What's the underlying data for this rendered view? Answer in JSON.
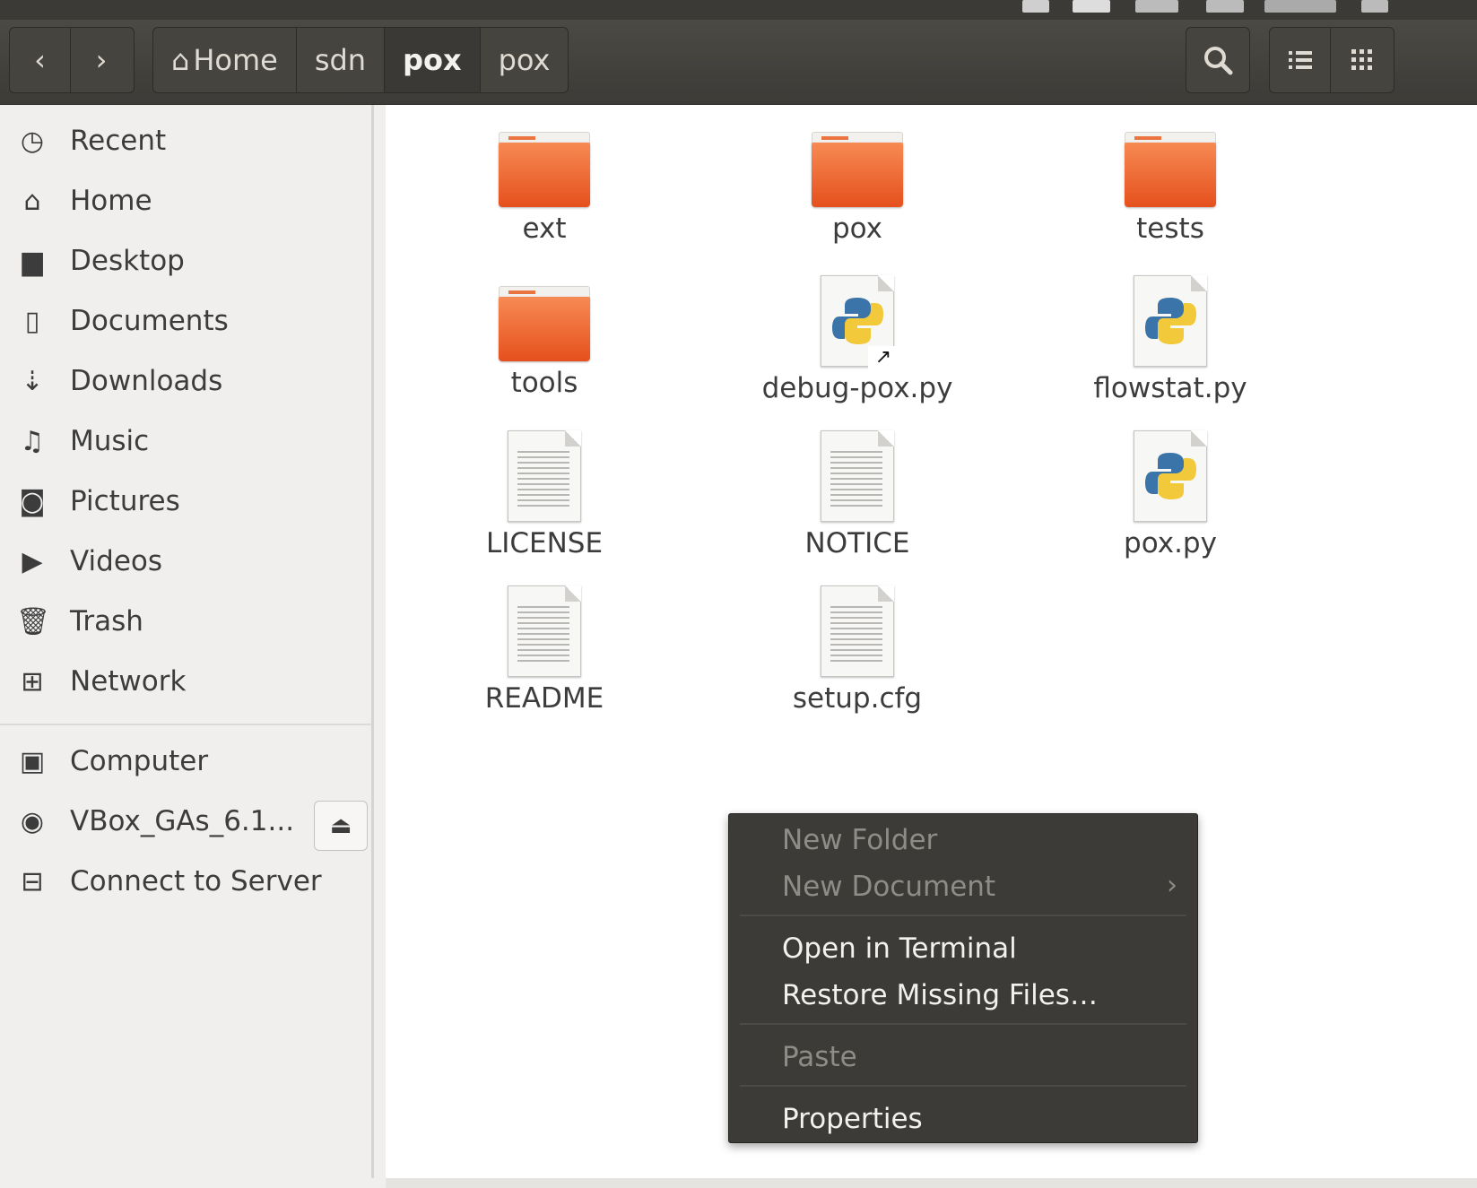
{
  "toolbar": {
    "back_icon": "‹",
    "forward_icon": "›",
    "breadcrumbs": [
      {
        "label": "Home"
      },
      {
        "label": "sdn"
      },
      {
        "label": "pox"
      },
      {
        "label": "pox"
      }
    ],
    "search_icon": "search-icon",
    "list_view_icon": "list-view-icon",
    "grid_view_icon": "grid-view-icon"
  },
  "sidebar": {
    "items": [
      {
        "label": "Recent",
        "icon": "clock-icon"
      },
      {
        "label": "Home",
        "icon": "home-icon"
      },
      {
        "label": "Desktop",
        "icon": "desktop-folder-icon"
      },
      {
        "label": "Documents",
        "icon": "document-icon"
      },
      {
        "label": "Downloads",
        "icon": "download-icon"
      },
      {
        "label": "Music",
        "icon": "music-icon"
      },
      {
        "label": "Pictures",
        "icon": "camera-icon"
      },
      {
        "label": "Videos",
        "icon": "video-icon"
      },
      {
        "label": "Trash",
        "icon": "trash-icon"
      },
      {
        "label": "Network",
        "icon": "network-icon"
      },
      {
        "label": "Computer",
        "icon": "computer-icon"
      },
      {
        "label": "VBox_GAs_6.1...",
        "icon": "disc-icon"
      },
      {
        "label": "Connect to Server",
        "icon": "server-icon"
      }
    ]
  },
  "files": [
    {
      "name": "ext",
      "type": "folder"
    },
    {
      "name": "pox",
      "type": "folder"
    },
    {
      "name": "tests",
      "type": "folder"
    },
    {
      "name": "tools",
      "type": "folder"
    },
    {
      "name": "debug-pox.py",
      "type": "python-link"
    },
    {
      "name": "flowstat.py",
      "type": "python"
    },
    {
      "name": "LICENSE",
      "type": "text"
    },
    {
      "name": "NOTICE",
      "type": "text"
    },
    {
      "name": "pox.py",
      "type": "python"
    },
    {
      "name": "README",
      "type": "text"
    },
    {
      "name": "setup.cfg",
      "type": "text"
    }
  ],
  "context_menu": {
    "new_folder": "New Folder",
    "new_document": "New Document",
    "open_terminal": "Open in Terminal",
    "restore_missing": "Restore Missing Files…",
    "paste": "Paste",
    "properties": "Properties"
  },
  "colors": {
    "folder_orange": "#e5501d",
    "toolbar_dark": "#3c3b37",
    "menu_bg": "#3c3b37"
  }
}
